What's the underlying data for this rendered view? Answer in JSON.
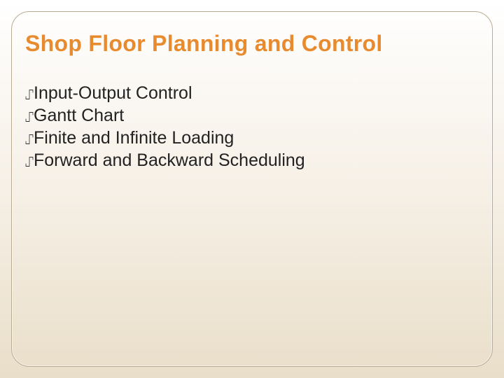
{
  "title": "Shop Floor Planning and Control",
  "bullets": {
    "glyph": "⑀",
    "items": [
      "Input-Output Control",
      "Gantt Chart",
      "Finite and Infinite Loading",
      "Forward and Backward Scheduling"
    ]
  }
}
